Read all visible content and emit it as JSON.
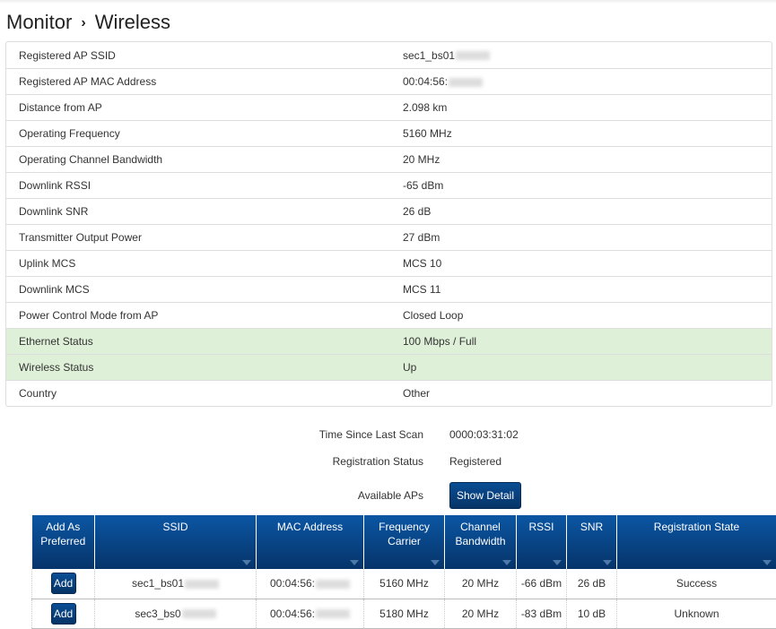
{
  "breadcrumb": {
    "section": "Monitor",
    "page": "Wireless"
  },
  "details": [
    {
      "label": "Registered AP SSID",
      "value": "sec1_bs01",
      "blurred": true
    },
    {
      "label": "Registered AP MAC Address",
      "value": "00:04:56:",
      "blurred": true
    },
    {
      "label": "Distance from AP",
      "value": "2.098 km"
    },
    {
      "label": "Operating Frequency",
      "value": "5160 MHz"
    },
    {
      "label": "Operating Channel Bandwidth",
      "value": "20 MHz"
    },
    {
      "label": "Downlink RSSI",
      "value": "-65 dBm"
    },
    {
      "label": "Downlink SNR",
      "value": "26 dB"
    },
    {
      "label": "Transmitter Output Power",
      "value": "27 dBm"
    },
    {
      "label": "Uplink MCS",
      "value": "MCS 10"
    },
    {
      "label": "Downlink MCS",
      "value": "MCS 11"
    },
    {
      "label": "Power Control Mode from AP",
      "value": "Closed Loop"
    },
    {
      "label": "Ethernet Status",
      "value": "100 Mbps / Full",
      "status": "ok"
    },
    {
      "label": "Wireless Status",
      "value": "Up",
      "status": "ok"
    },
    {
      "label": "Country",
      "value": "Other"
    }
  ],
  "scan": {
    "time_label": "Time Since Last Scan",
    "time_value": "0000:03:31:02",
    "reg_label": "Registration Status",
    "reg_value": "Registered",
    "aps_label": "Available APs",
    "show_detail": "Show Detail"
  },
  "ap_table": {
    "headers": [
      "Add As Preferred",
      "SSID",
      "MAC Address",
      "Frequency Carrier",
      "Channel Bandwidth",
      "RSSI",
      "SNR",
      "Registration State"
    ],
    "rows": [
      {
        "add": "Add",
        "ssid": "sec1_bs01",
        "mac": "00:04:56:",
        "freq": "5160 MHz",
        "bw": "20 MHz",
        "rssi": "-66 dBm",
        "snr": "26 dB",
        "state": "Success"
      },
      {
        "add": "Add",
        "ssid": "sec3_bs0",
        "mac": "00:04:56:",
        "freq": "5180 MHz",
        "bw": "20 MHz",
        "rssi": "-83 dBm",
        "snr": "10 dB",
        "state": "Unknown"
      }
    ]
  },
  "colors": {
    "ok_row": "#dff0d8",
    "header_blue": "#0b56a3"
  }
}
